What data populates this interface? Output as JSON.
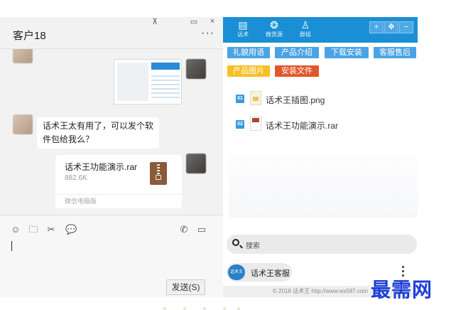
{
  "chat": {
    "title": "客户18",
    "window_controls": {
      "pin": "⊼",
      "minimize": "▭",
      "close": "×"
    },
    "more": "···",
    "messages": {
      "text": "话术王太有用了，可以发个软件包给我么？",
      "file": {
        "name": "话术王功能演示.rar",
        "size": "882.6K",
        "source": "微信电脑版"
      }
    },
    "toolbar": {
      "emoji": "☺",
      "folder": "🗀",
      "scissors": "✂",
      "chat": "💬",
      "phone": "✆",
      "video": "▭"
    },
    "send_label": "发送(S)"
  },
  "panel": {
    "tabs": [
      {
        "icon": "chat-bubble-icon",
        "label": "话术"
      },
      {
        "icon": "wechat-circle-icon",
        "label": "微货源"
      },
      {
        "icon": "group-icon",
        "label": "群组"
      }
    ],
    "header_buttons": [
      "+",
      "✥",
      "−"
    ],
    "tags": [
      {
        "label": "礼貌用语",
        "color": "#4aa3e4"
      },
      {
        "label": "产品介绍",
        "color": "#4aa3e4"
      },
      {
        "label": "下载安装",
        "color": "#4aa3e4"
      },
      {
        "label": "客服售后",
        "color": "#4aa3e4"
      },
      {
        "label": "产品图片",
        "color": "#f6c026"
      },
      {
        "label": "安装文件",
        "color": "#e1572b"
      }
    ],
    "files": [
      {
        "num": "01",
        "name": "话术王插图.png"
      },
      {
        "num": "02",
        "name": "话术王功能演示.rar"
      }
    ],
    "search_placeholder": "搜索",
    "contact": {
      "avatar_text": "话术王",
      "name": "话术王客服"
    },
    "footer": "© 2018 话术王 http://www.wx587.com"
  },
  "watermark": "最需网"
}
